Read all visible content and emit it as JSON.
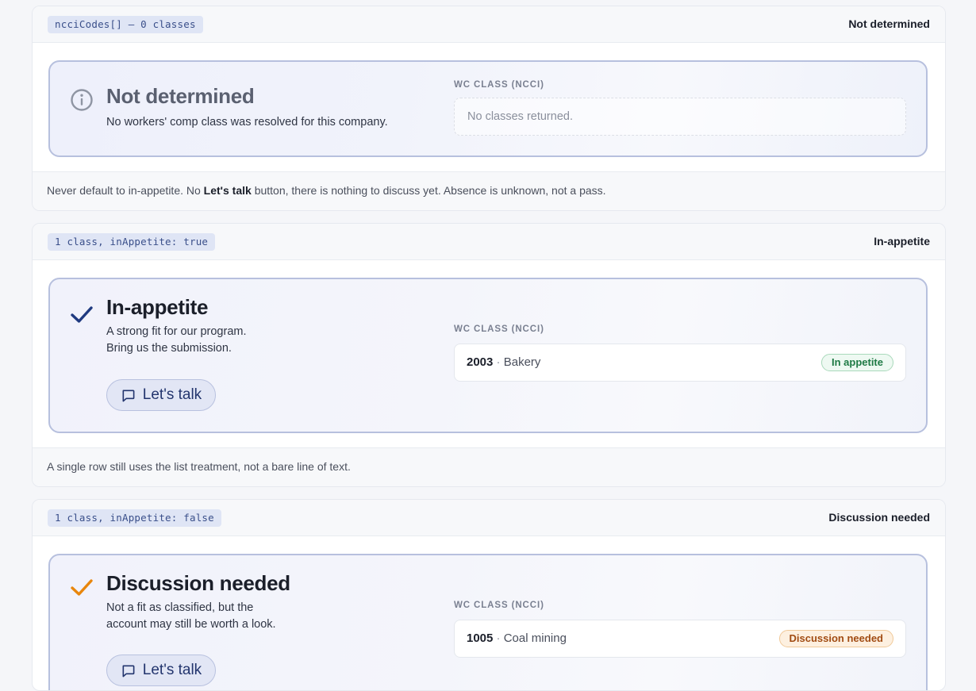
{
  "sections": [
    {
      "code": "ncciCodes[] — 0 classes",
      "status": "Not determined",
      "card": {
        "title": "Not determined",
        "desc": "No workers' comp class was resolved for this company.",
        "wc_label": "WC CLASS (NCCI)",
        "empty_text": "No classes returned.",
        "title_color": "#5a6070",
        "icon": "info-circle-icon"
      },
      "footer": {
        "pre": "Never default to in-appetite. No ",
        "bold": "Let's talk",
        "post": " button, there is nothing to discuss yet. Absence is unknown, not a pass."
      }
    },
    {
      "code": "1 class, inAppetite: true",
      "status": "In-appetite",
      "card": {
        "title": "In-appetite",
        "desc_lines": [
          "A strong fit for our program.",
          "Bring us the submission."
        ],
        "button": "Let's talk",
        "wc_label": "WC CLASS (NCCI)",
        "class_code": "2003",
        "class_sep": "·",
        "class_name": "Bakery",
        "badge": "In appetite",
        "icon": "checkmark-icon",
        "icon_color": "#1f3a80"
      },
      "footer": {
        "text": "A single row still uses the list treatment, not a bare line of text."
      }
    },
    {
      "code": "1 class, inAppetite: false",
      "status": "Discussion needed",
      "card": {
        "title": "Discussion needed",
        "desc_lines": [
          "Not a fit as classified, but the",
          "account may still be worth a look."
        ],
        "button": "Let's talk",
        "wc_label": "WC CLASS (NCCI)",
        "class_code": "1005",
        "class_sep": "·",
        "class_name": "Coal mining",
        "badge": "Discussion needed",
        "icon": "checkmark-icon",
        "icon_color": "#e8860c"
      }
    }
  ]
}
